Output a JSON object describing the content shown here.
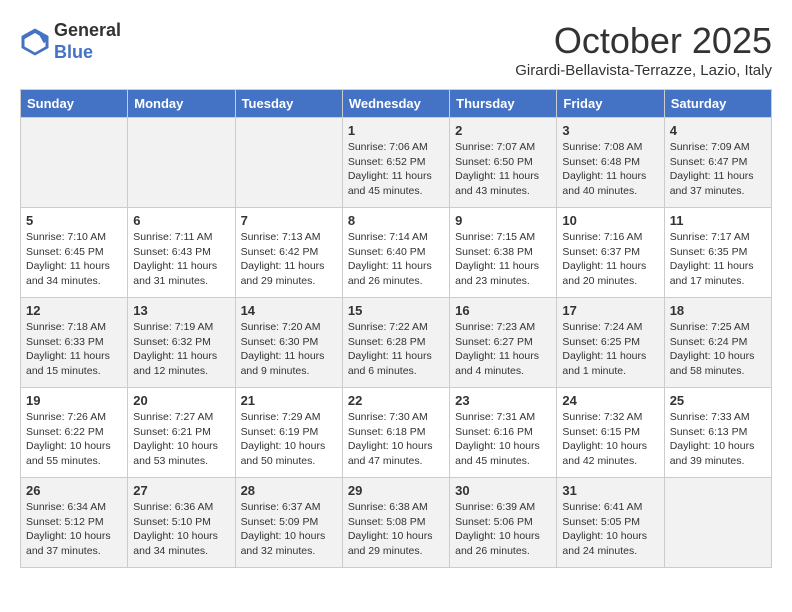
{
  "header": {
    "logo_line1": "General",
    "logo_line2": "Blue",
    "month": "October 2025",
    "location": "Girardi-Bellavista-Terrazze, Lazio, Italy"
  },
  "days_of_week": [
    "Sunday",
    "Monday",
    "Tuesday",
    "Wednesday",
    "Thursday",
    "Friday",
    "Saturday"
  ],
  "weeks": [
    [
      {
        "day": "",
        "content": ""
      },
      {
        "day": "",
        "content": ""
      },
      {
        "day": "",
        "content": ""
      },
      {
        "day": "1",
        "content": "Sunrise: 7:06 AM\nSunset: 6:52 PM\nDaylight: 11 hours and 45 minutes."
      },
      {
        "day": "2",
        "content": "Sunrise: 7:07 AM\nSunset: 6:50 PM\nDaylight: 11 hours and 43 minutes."
      },
      {
        "day": "3",
        "content": "Sunrise: 7:08 AM\nSunset: 6:48 PM\nDaylight: 11 hours and 40 minutes."
      },
      {
        "day": "4",
        "content": "Sunrise: 7:09 AM\nSunset: 6:47 PM\nDaylight: 11 hours and 37 minutes."
      }
    ],
    [
      {
        "day": "5",
        "content": "Sunrise: 7:10 AM\nSunset: 6:45 PM\nDaylight: 11 hours and 34 minutes."
      },
      {
        "day": "6",
        "content": "Sunrise: 7:11 AM\nSunset: 6:43 PM\nDaylight: 11 hours and 31 minutes."
      },
      {
        "day": "7",
        "content": "Sunrise: 7:13 AM\nSunset: 6:42 PM\nDaylight: 11 hours and 29 minutes."
      },
      {
        "day": "8",
        "content": "Sunrise: 7:14 AM\nSunset: 6:40 PM\nDaylight: 11 hours and 26 minutes."
      },
      {
        "day": "9",
        "content": "Sunrise: 7:15 AM\nSunset: 6:38 PM\nDaylight: 11 hours and 23 minutes."
      },
      {
        "day": "10",
        "content": "Sunrise: 7:16 AM\nSunset: 6:37 PM\nDaylight: 11 hours and 20 minutes."
      },
      {
        "day": "11",
        "content": "Sunrise: 7:17 AM\nSunset: 6:35 PM\nDaylight: 11 hours and 17 minutes."
      }
    ],
    [
      {
        "day": "12",
        "content": "Sunrise: 7:18 AM\nSunset: 6:33 PM\nDaylight: 11 hours and 15 minutes."
      },
      {
        "day": "13",
        "content": "Sunrise: 7:19 AM\nSunset: 6:32 PM\nDaylight: 11 hours and 12 minutes."
      },
      {
        "day": "14",
        "content": "Sunrise: 7:20 AM\nSunset: 6:30 PM\nDaylight: 11 hours and 9 minutes."
      },
      {
        "day": "15",
        "content": "Sunrise: 7:22 AM\nSunset: 6:28 PM\nDaylight: 11 hours and 6 minutes."
      },
      {
        "day": "16",
        "content": "Sunrise: 7:23 AM\nSunset: 6:27 PM\nDaylight: 11 hours and 4 minutes."
      },
      {
        "day": "17",
        "content": "Sunrise: 7:24 AM\nSunset: 6:25 PM\nDaylight: 11 hours and 1 minute."
      },
      {
        "day": "18",
        "content": "Sunrise: 7:25 AM\nSunset: 6:24 PM\nDaylight: 10 hours and 58 minutes."
      }
    ],
    [
      {
        "day": "19",
        "content": "Sunrise: 7:26 AM\nSunset: 6:22 PM\nDaylight: 10 hours and 55 minutes."
      },
      {
        "day": "20",
        "content": "Sunrise: 7:27 AM\nSunset: 6:21 PM\nDaylight: 10 hours and 53 minutes."
      },
      {
        "day": "21",
        "content": "Sunrise: 7:29 AM\nSunset: 6:19 PM\nDaylight: 10 hours and 50 minutes."
      },
      {
        "day": "22",
        "content": "Sunrise: 7:30 AM\nSunset: 6:18 PM\nDaylight: 10 hours and 47 minutes."
      },
      {
        "day": "23",
        "content": "Sunrise: 7:31 AM\nSunset: 6:16 PM\nDaylight: 10 hours and 45 minutes."
      },
      {
        "day": "24",
        "content": "Sunrise: 7:32 AM\nSunset: 6:15 PM\nDaylight: 10 hours and 42 minutes."
      },
      {
        "day": "25",
        "content": "Sunrise: 7:33 AM\nSunset: 6:13 PM\nDaylight: 10 hours and 39 minutes."
      }
    ],
    [
      {
        "day": "26",
        "content": "Sunrise: 6:34 AM\nSunset: 5:12 PM\nDaylight: 10 hours and 37 minutes."
      },
      {
        "day": "27",
        "content": "Sunrise: 6:36 AM\nSunset: 5:10 PM\nDaylight: 10 hours and 34 minutes."
      },
      {
        "day": "28",
        "content": "Sunrise: 6:37 AM\nSunset: 5:09 PM\nDaylight: 10 hours and 32 minutes."
      },
      {
        "day": "29",
        "content": "Sunrise: 6:38 AM\nSunset: 5:08 PM\nDaylight: 10 hours and 29 minutes."
      },
      {
        "day": "30",
        "content": "Sunrise: 6:39 AM\nSunset: 5:06 PM\nDaylight: 10 hours and 26 minutes."
      },
      {
        "day": "31",
        "content": "Sunrise: 6:41 AM\nSunset: 5:05 PM\nDaylight: 10 hours and 24 minutes."
      },
      {
        "day": "",
        "content": ""
      }
    ]
  ]
}
